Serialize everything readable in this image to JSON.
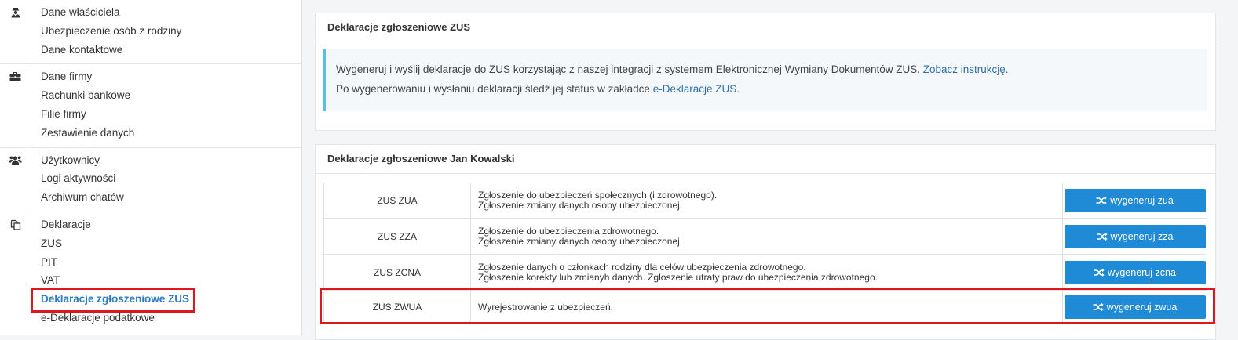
{
  "sidebar": {
    "groups": [
      {
        "icon": "user-secret-icon",
        "items": [
          "Dane właściciela",
          "Ubezpieczenie osób z rodziny",
          "Dane kontaktowe"
        ]
      },
      {
        "icon": "briefcase-icon",
        "items": [
          "Dane firmy",
          "Rachunki bankowe",
          "Filie firmy",
          "Zestawienie danych"
        ]
      },
      {
        "icon": "users-icon",
        "items": [
          "Użytkownicy",
          "Logi aktywności",
          "Archiwum chatów"
        ]
      },
      {
        "icon": "copy-icon",
        "items": [
          "Deklaracje",
          "ZUS",
          "PIT",
          "VAT",
          "Deklaracje zgłoszeniowe ZUS",
          "e-Deklaracje podatkowe"
        ]
      }
    ],
    "active_item": "Deklaracje zgłoszeniowe ZUS"
  },
  "panel1": {
    "title": "Deklaracje zgłoszeniowe ZUS",
    "info_line1_text": "Wygeneruj i wyślij deklaracje do ZUS korzystając z naszej integracji z systemem Elektronicznej Wymiany Dokumentów ZUS. ",
    "info_line1_link": "Zobacz instrukcję.",
    "info_line2_text": "Po wygenerowaniu i wysłaniu deklaracji śledź jej status w zakładce ",
    "info_line2_link": "e-Deklaracje ZUS."
  },
  "panel2": {
    "title": "Deklaracje zgłoszeniowe Jan Kowalski",
    "rows": [
      {
        "code": "ZUS ZUA",
        "desc": [
          "Zgłoszenie do ubezpieczeń społecznych (i zdrowotnego).",
          "Zgłoszenie zmiany danych osoby ubezpieczonej."
        ],
        "button": "wygeneruj zua"
      },
      {
        "code": "ZUS ZZA",
        "desc": [
          "Zgłoszenie do ubezpieczenia zdrowotnego.",
          "Zgłoszenie zmiany danych osoby ubezpieczonej."
        ],
        "button": "wygeneruj zza"
      },
      {
        "code": "ZUS ZCNA",
        "desc": [
          "Zgłoszenie danych o członkach rodziny dla celów ubezpieczenia zdrowotnego.",
          "Zgłoszenie korekty lub zmianyh danych. Zgłoszenie utraty praw do ubezpieczenia zdrowotnego."
        ],
        "button": "wygeneruj zcna"
      },
      {
        "code": "ZUS ZWUA",
        "desc": [
          "Wyrejestrowanie z ubezpieczeń."
        ],
        "button": "wygeneruj zwua"
      }
    ]
  },
  "colors": {
    "accent": "#1f8ad6",
    "highlight": "#e0161f",
    "info_border": "#5bc0de",
    "link": "#2f6ea5"
  }
}
